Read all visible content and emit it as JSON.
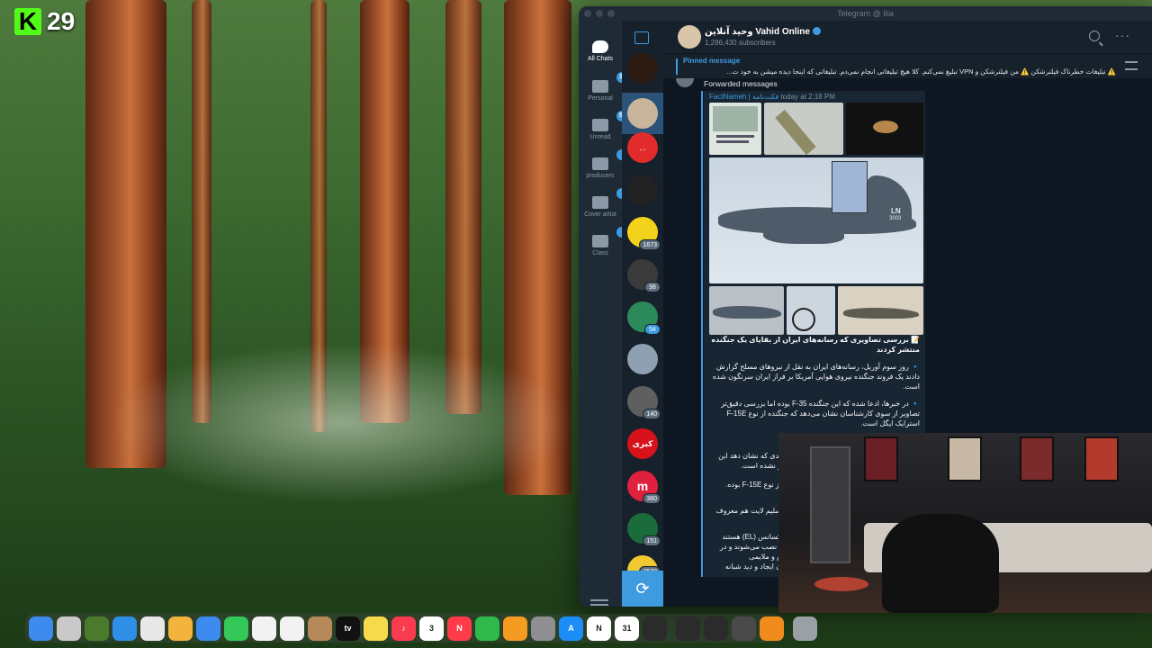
{
  "stream": {
    "badge_letter": "K",
    "badge_number": "29"
  },
  "window": {
    "title": "Telegram @ Ilia"
  },
  "folders": [
    {
      "label": "All Chats",
      "badge": "",
      "icon": "chat-bubbles-icon"
    },
    {
      "label": "Personal",
      "badge": "393",
      "icon": "folder-icon"
    },
    {
      "label": "Unread",
      "badge": "534",
      "icon": "chat-bubble-icon"
    },
    {
      "label": "producers",
      "badge": "3",
      "icon": "folder-icon"
    },
    {
      "label": "Cover artist",
      "badge": "1",
      "icon": "folder-icon"
    },
    {
      "label": "Class",
      "badge": "2",
      "icon": "folder-icon"
    }
  ],
  "chat_list_counts": {
    "c4": "1673",
    "c5": "98",
    "c6": "54",
    "c8": "140",
    "c10": "380",
    "c11": "151",
    "c12": "2589"
  },
  "chat_list_texts": {
    "red_box": "...",
    "kebri": "کبری",
    "m_logo": "m"
  },
  "channel": {
    "name": "وحید آنلاین Vahid Online",
    "subscribers": "1,286,430 subscribers"
  },
  "pinned": {
    "title": "Pinned message",
    "text": "⚠️ تبلیغات خطرناک فیلترشکن ⚠️  من فیلترشکن و VPN تبلیغ نمی‌کنم. کلا هیچ تبلیغاتی انجام نمی‌دم. تبلیغاتی که اینجا دیده میشن به خود ت..."
  },
  "message": {
    "forwarded_label": "Forwarded messages",
    "from": "FactNameh | فکت‌نامه",
    "time": "today at 2:18 PM",
    "title": "📝 بررسی تصاویری که رسانه‌های ایران از بقایای یک جنگنده منتشر کردند",
    "p1": "🔹 روز سوم آوریل، رسانه‌های ایران به نقل از نیروهای مسلح گزارش دادند یک فروند جنگنده نیروی هوایی آمریکا بر فراز ایران سرنگون شده است.",
    "p2": "🔹 در خبرها، ادعا شده که این جنگنده F-35 بوده اما بررسی دقیق‌تر تصاویر از سوی کارشناسان نشان می‌دهد که جنگنده از نوع F-15E استرایک ایگل است.",
    "overflow_1": "ندی که نشان دهد این",
    "overflow_2": "ر نشده است.",
    "overflow_3": "از نوع F-15E بوده.",
    "overflow_4": "سلیم لایت هم معروف",
    "overflow_5": "کسانس (EL) هستند",
    "overflow_6": ") نصب می‌شوند و در",
    "overflow_7": "م و ملایمی",
    "overflow_8": "ن ایجاد و دید شبانه",
    "photo_texts": {
      "tail_letters": "LN",
      "tail_number": "3003"
    }
  },
  "dock": [
    {
      "name": "finder",
      "label": "",
      "color": "#3d8bef"
    },
    {
      "name": "launchpad",
      "label": "",
      "color": "#c9c9c9"
    },
    {
      "name": "app-green",
      "label": "",
      "color": "#4a7b2c"
    },
    {
      "name": "safari",
      "label": "",
      "color": "#2f8fe8"
    },
    {
      "name": "chrome",
      "label": "",
      "color": "#e8e8e8"
    },
    {
      "name": "photos",
      "label": "",
      "color": "#f3b33d"
    },
    {
      "name": "mail",
      "label": "",
      "color": "#3d8bef"
    },
    {
      "name": "facetime",
      "label": "",
      "color": "#34c759"
    },
    {
      "name": "reminders",
      "label": "",
      "color": "#f2f2f2"
    },
    {
      "name": "freeform",
      "label": "",
      "color": "#f2f2f2"
    },
    {
      "name": "contacts",
      "label": "",
      "color": "#b7895a"
    },
    {
      "name": "apple-tv",
      "label": "tv",
      "color": "#111111"
    },
    {
      "name": "notes",
      "label": "",
      "color": "#f7d94c"
    },
    {
      "name": "music",
      "label": "♪",
      "color": "#fa3b4f"
    },
    {
      "name": "calendar",
      "label": "3",
      "color": "#ffffff"
    },
    {
      "name": "news",
      "label": "N",
      "color": "#ff3b4a"
    },
    {
      "name": "numbers",
      "label": "",
      "color": "#2fb84b"
    },
    {
      "name": "pages",
      "label": "",
      "color": "#f59b22"
    },
    {
      "name": "system-settings",
      "label": "",
      "color": "#8e8e93"
    },
    {
      "name": "app-store",
      "label": "A",
      "color": "#1c8cf7"
    },
    {
      "name": "notion",
      "label": "N",
      "color": "#ffffff"
    },
    {
      "name": "calendar-2",
      "label": "31",
      "color": "#ffffff"
    },
    {
      "name": "app-dark-1",
      "label": "",
      "color": "#2b2b2b"
    },
    {
      "name": "app-dark-2",
      "label": "",
      "color": "#2b2b2b"
    },
    {
      "name": "unity",
      "label": "",
      "color": "#2b2b2b"
    },
    {
      "name": "app-gray",
      "label": "",
      "color": "#4a4a4a"
    },
    {
      "name": "fl-studio",
      "label": "",
      "color": "#f18b1e"
    },
    {
      "name": "trash",
      "label": "",
      "color": "#9aa0a6"
    }
  ]
}
